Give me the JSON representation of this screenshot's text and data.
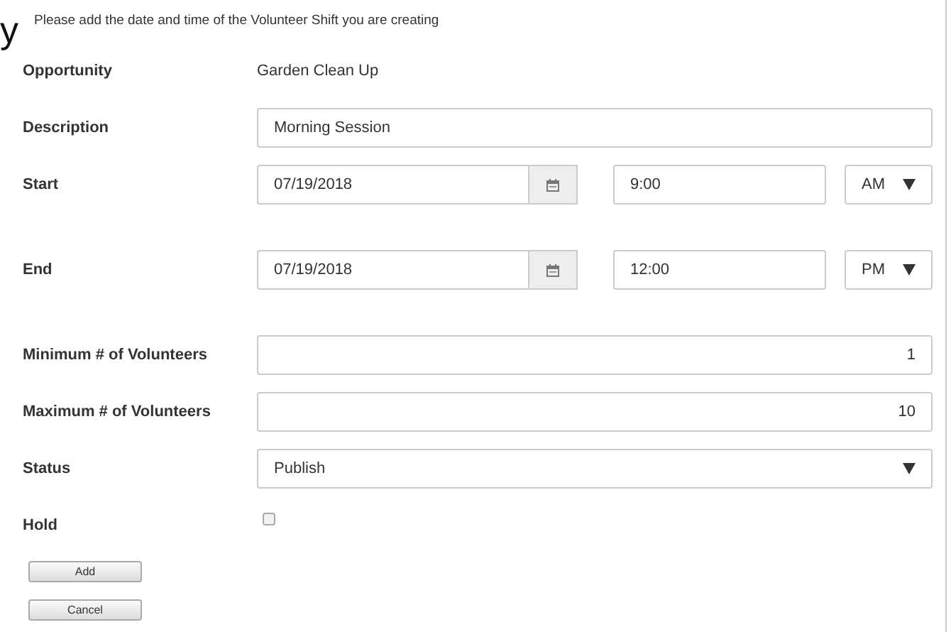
{
  "heading_fragment": "y",
  "intro": "Please add the date and time of the Volunteer Shift you are creating",
  "fields": [
    {
      "kind": "text",
      "label": "Opportunity",
      "value": "Garden Clean Up"
    },
    {
      "kind": "input",
      "label": "Description",
      "value": "Morning Session"
    },
    {
      "kind": "datetime",
      "label": "Start",
      "date": "07/19/2018",
      "time": "9:00",
      "period": "AM"
    },
    {
      "kind": "datetime",
      "label": "End",
      "date": "07/19/2018",
      "time": "12:00",
      "period": "PM"
    },
    {
      "kind": "number",
      "label": "Minimum # of Volunteers",
      "value": "1"
    },
    {
      "kind": "number",
      "label": "Maximum # of Volunteers",
      "value": "10"
    },
    {
      "kind": "select",
      "label": "Status",
      "value": "Publish"
    },
    {
      "kind": "checkbox",
      "label": "Hold",
      "checked": false
    }
  ],
  "buttons": [
    "Add",
    "Cancel"
  ]
}
